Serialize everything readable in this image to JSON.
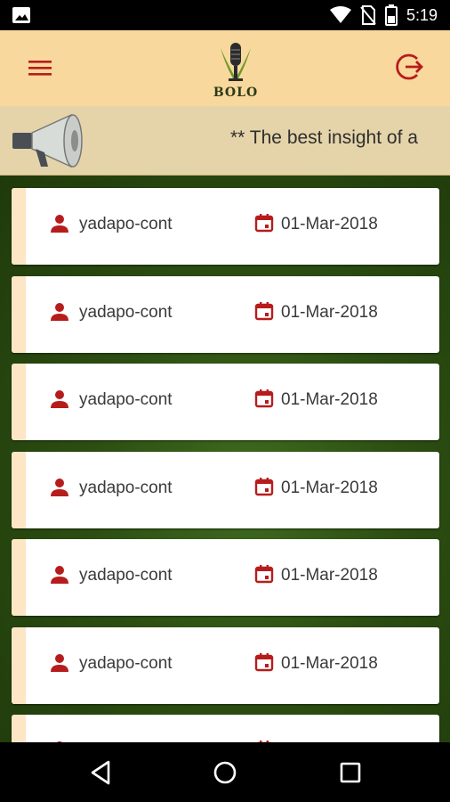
{
  "status_bar": {
    "time": "5:19",
    "icons": [
      "gallery-icon",
      "wifi-icon",
      "no-sim-icon",
      "battery-icon"
    ]
  },
  "app_bar": {
    "logo_text": "BOLO",
    "menu_icon": "hamburger-menu-icon",
    "logout_icon": "logout-icon",
    "background": "#f8d89c",
    "icon_color": "#b71c1c"
  },
  "announcement": {
    "text": "** The best insight of a",
    "icon": "megaphone-icon"
  },
  "posts": [
    {
      "user": "yadapo-cont",
      "date": "01-Mar-2018"
    },
    {
      "user": "yadapo-cont",
      "date": "01-Mar-2018"
    },
    {
      "user": "yadapo-cont",
      "date": "01-Mar-2018"
    },
    {
      "user": "yadapo-cont",
      "date": "01-Mar-2018"
    },
    {
      "user": "yadapo-cont",
      "date": "01-Mar-2018"
    },
    {
      "user": "yadapo-cont",
      "date": "01-Mar-2018"
    },
    {
      "user": "",
      "date": ""
    }
  ],
  "nav_bar": {
    "buttons": [
      "back-icon",
      "home-icon",
      "recents-icon"
    ]
  }
}
